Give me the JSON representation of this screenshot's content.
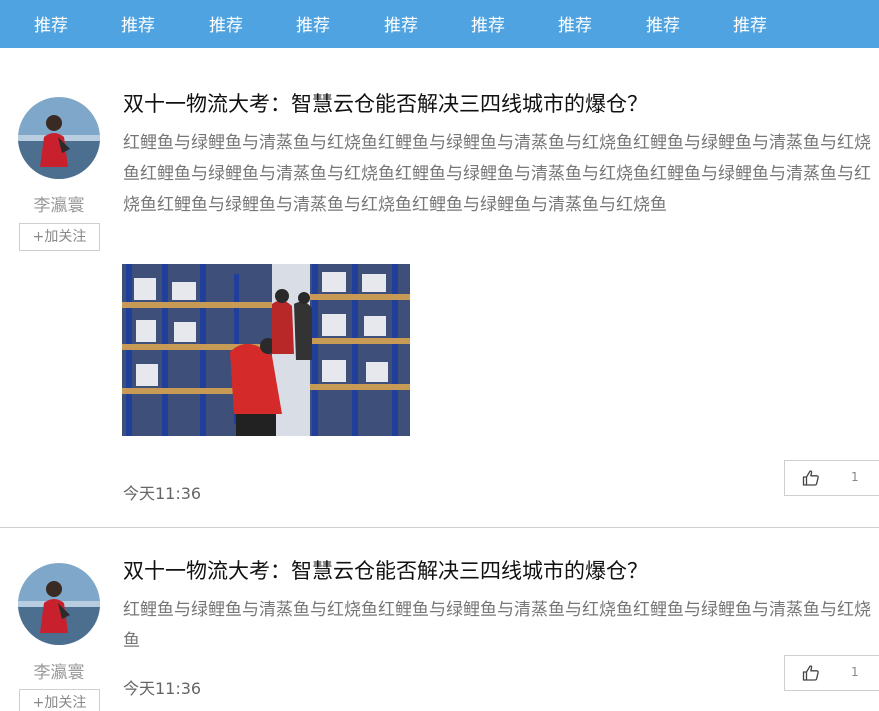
{
  "nav": {
    "tabs": [
      "推荐",
      "推荐",
      "推荐",
      "推荐",
      "推荐",
      "推荐",
      "推荐",
      "推荐",
      "推荐"
    ]
  },
  "posts": [
    {
      "author": "李瀛寰",
      "follow_label": "+加关注",
      "title": "双十一物流大考：智慧云仓能否解决三四线城市的爆仓？",
      "body": "红鲤鱼与绿鲤鱼与清蒸鱼与红烧鱼红鲤鱼与绿鲤鱼与清蒸鱼与红烧鱼红鲤鱼与绿鲤鱼与清蒸鱼与红烧鱼红鲤鱼与绿鲤鱼与清蒸鱼与红烧鱼红鲤鱼与绿鲤鱼与清蒸鱼与红烧鱼红鲤鱼与绿鲤鱼与清蒸鱼与红烧鱼红鲤鱼与绿鲤鱼与清蒸鱼与红烧鱼红鲤鱼与绿鲤鱼与清蒸鱼与红烧鱼",
      "time": "今天11:36",
      "likes": "1"
    },
    {
      "author": "李瀛寰",
      "follow_label": "+加关注",
      "title": "双十一物流大考：智慧云仓能否解决三四线城市的爆仓？",
      "body": "红鲤鱼与绿鲤鱼与清蒸鱼与红烧鱼红鲤鱼与绿鲤鱼与清蒸鱼与红烧鱼红鲤鱼与绿鲤鱼与清蒸鱼与红烧鱼",
      "time": "今天11:36",
      "likes": "1"
    }
  ],
  "colors": {
    "nav_bg": "#4fa3e0",
    "nav_text": "#ffffff",
    "divider": "#cfcfcf"
  },
  "icons": {
    "like": "thumbs-up-icon"
  }
}
